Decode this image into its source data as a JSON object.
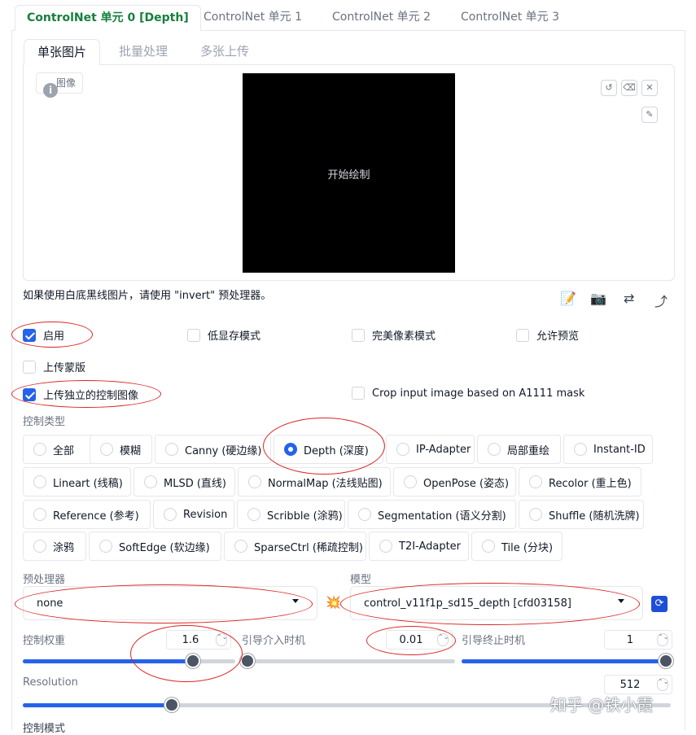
{
  "unit_tabs": [
    "ControlNet 单元 0 [Depth]",
    "ControlNet 单元 1",
    "ControlNet 单元 2",
    "ControlNet 单元 3"
  ],
  "image_tabs": [
    "单张图片",
    "批量处理",
    "多张上传"
  ],
  "image_panel": {
    "label": "图像",
    "info_glyph": "i",
    "canvas_text": "开始绘制",
    "tools": [
      "↺",
      "⌫",
      "✕",
      "✎"
    ]
  },
  "hint_text": "如果使用白底黑线图片，请使用 \"invert\" 预处理器。",
  "side_icons": [
    "📝",
    "📷",
    "⇄",
    "⤴"
  ],
  "checkboxes": {
    "enable": {
      "label": "启用",
      "checked": true
    },
    "low_vram": {
      "label": "低显存模式",
      "checked": false
    },
    "pixel_perfect": {
      "label": "完美像素模式",
      "checked": false
    },
    "allow_preview": {
      "label": "允许预览",
      "checked": false
    },
    "upload_mask": {
      "label": "上传蒙版",
      "checked": false
    },
    "upload_independent": {
      "label": "上传独立的控制图像",
      "checked": true
    },
    "crop_input": {
      "label": "Crop input image based on A1111 mask",
      "checked": false
    }
  },
  "control_type": {
    "label": "控制类型",
    "options": [
      {
        "label": "全部",
        "selected": false
      },
      {
        "label": "模糊",
        "selected": false
      },
      {
        "label": "Canny (硬边缘)",
        "selected": false
      },
      {
        "label": "Depth (深度)",
        "selected": true
      },
      {
        "label": "IP-Adapter",
        "selected": false
      },
      {
        "label": "局部重绘",
        "selected": false
      },
      {
        "label": "Instant-ID",
        "selected": false
      },
      {
        "label": "Lineart (线稿)",
        "selected": false
      },
      {
        "label": "MLSD (直线)",
        "selected": false
      },
      {
        "label": "NormalMap (法线贴图)",
        "selected": false
      },
      {
        "label": "OpenPose (姿态)",
        "selected": false
      },
      {
        "label": "Recolor (重上色)",
        "selected": false
      },
      {
        "label": "Reference (参考)",
        "selected": false
      },
      {
        "label": "Revision",
        "selected": false
      },
      {
        "label": "Scribble (涂鸦)",
        "selected": false
      },
      {
        "label": "Segmentation (语义分割)",
        "selected": false
      },
      {
        "label": "Shuffle (随机洗牌)",
        "selected": false
      },
      {
        "label": "涂鸦",
        "selected": false
      },
      {
        "label": "SoftEdge (软边缘)",
        "selected": false
      },
      {
        "label": "SparseCtrl (稀疏控制)",
        "selected": false
      },
      {
        "label": "T2I-Adapter",
        "selected": false
      },
      {
        "label": "Tile (分块)",
        "selected": false
      }
    ]
  },
  "preprocessor": {
    "label": "预处理器",
    "value": "none"
  },
  "model": {
    "label": "模型",
    "value": "control_v11f1p_sd15_depth [cfd03158]",
    "icon": "💥",
    "refresh_glyph": "⟳"
  },
  "sliders": {
    "weight": {
      "label": "控制权重",
      "value": "1.6",
      "fraction": 0.8
    },
    "start": {
      "label": "引导介入时机",
      "value": "0.01",
      "fraction": 0.01
    },
    "end": {
      "label": "引导终止时机",
      "value": "1",
      "fraction": 1.0
    },
    "resolution": {
      "label": "Resolution",
      "value": "512",
      "fraction": 0.23
    }
  },
  "spin_glyph": "⌃⌄",
  "control_mode_label": "控制模式",
  "watermark": "知乎 @铁小霞"
}
